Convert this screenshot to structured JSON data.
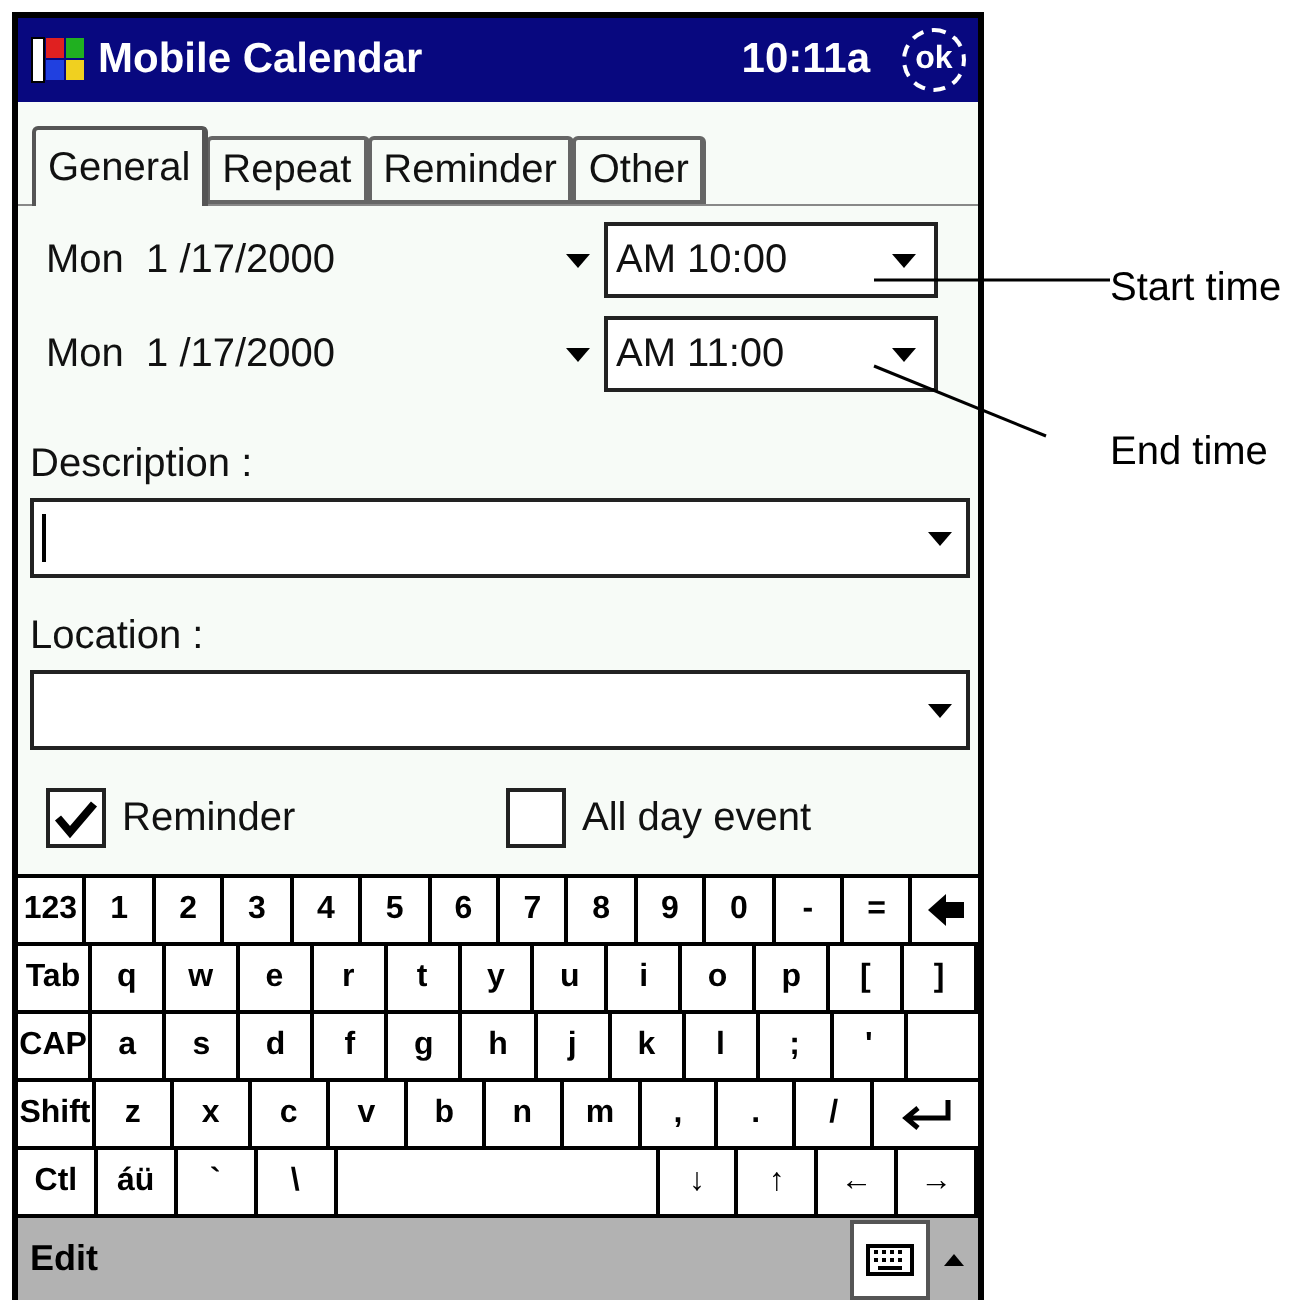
{
  "title_bar": {
    "app_name": "Mobile Calendar",
    "time": "10:11a",
    "ok_button": "ok"
  },
  "tabs": [
    {
      "label": "General",
      "selected": true
    },
    {
      "label": "Repeat",
      "selected": false
    },
    {
      "label": "Reminder",
      "selected": false
    },
    {
      "label": "Other",
      "selected": false
    }
  ],
  "date_rows": [
    {
      "date": "Mon  1 /17/2000",
      "time": "AM 10:00"
    },
    {
      "date": "Mon  1 /17/2000",
      "time": "AM 11:00"
    }
  ],
  "text_fields": [
    {
      "label": "Description :",
      "focused": true
    },
    {
      "label": "Location :",
      "focused": false
    }
  ],
  "options": [
    {
      "label": "Reminder",
      "checked": true
    },
    {
      "label": "All day event",
      "checked": false
    }
  ],
  "keyboard": [
    [
      {
        "kind": "char",
        "label": "123"
      },
      {
        "kind": "char",
        "label": "1"
      },
      {
        "kind": "char",
        "label": "2"
      },
      {
        "kind": "char",
        "label": "3"
      },
      {
        "kind": "char",
        "label": "4"
      },
      {
        "kind": "char",
        "label": "5"
      },
      {
        "kind": "char",
        "label": "6"
      },
      {
        "kind": "char",
        "label": "7"
      },
      {
        "kind": "char",
        "label": "8"
      },
      {
        "kind": "char",
        "label": "9"
      },
      {
        "kind": "char",
        "label": "0"
      },
      {
        "kind": "char",
        "label": "-"
      },
      {
        "kind": "char",
        "label": "="
      },
      {
        "kind": "backspace"
      }
    ],
    [
      {
        "kind": "char",
        "label": "Tab"
      },
      {
        "kind": "char",
        "label": "q"
      },
      {
        "kind": "char",
        "label": "w"
      },
      {
        "kind": "char",
        "label": "e"
      },
      {
        "kind": "char",
        "label": "r"
      },
      {
        "kind": "char",
        "label": "t"
      },
      {
        "kind": "char",
        "label": "y"
      },
      {
        "kind": "char",
        "label": "u"
      },
      {
        "kind": "char",
        "label": "i"
      },
      {
        "kind": "char",
        "label": "o"
      },
      {
        "kind": "char",
        "label": "p"
      },
      {
        "kind": "char",
        "label": "["
      },
      {
        "kind": "char",
        "label": "]"
      }
    ],
    [
      {
        "kind": "char",
        "label": "CAP"
      },
      {
        "kind": "char",
        "label": "a"
      },
      {
        "kind": "char",
        "label": "s"
      },
      {
        "kind": "char",
        "label": "d"
      },
      {
        "kind": "char",
        "label": "f"
      },
      {
        "kind": "char",
        "label": "g"
      },
      {
        "kind": "char",
        "label": "h"
      },
      {
        "kind": "char",
        "label": "j"
      },
      {
        "kind": "char",
        "label": "k"
      },
      {
        "kind": "char",
        "label": "l"
      },
      {
        "kind": "char",
        "label": ";"
      },
      {
        "kind": "char",
        "label": "'"
      },
      {
        "kind": "blank"
      }
    ],
    [
      {
        "kind": "char",
        "label": "Shift"
      },
      {
        "kind": "char",
        "label": "z"
      },
      {
        "kind": "char",
        "label": "x"
      },
      {
        "kind": "char",
        "label": "c"
      },
      {
        "kind": "char",
        "label": "v"
      },
      {
        "kind": "char",
        "label": "b"
      },
      {
        "kind": "char",
        "label": "n"
      },
      {
        "kind": "char",
        "label": "m"
      },
      {
        "kind": "char",
        "label": ","
      },
      {
        "kind": "char",
        "label": "."
      },
      {
        "kind": "char",
        "label": "/"
      },
      {
        "kind": "enter"
      }
    ],
    [
      {
        "kind": "char",
        "label": "Ctl"
      },
      {
        "kind": "char",
        "label": "áü"
      },
      {
        "kind": "char",
        "label": "`"
      },
      {
        "kind": "char",
        "label": "\\"
      },
      {
        "kind": "space"
      },
      {
        "kind": "char",
        "label": "↓"
      },
      {
        "kind": "char",
        "label": "↑"
      },
      {
        "kind": "char",
        "label": "←"
      },
      {
        "kind": "char",
        "label": "→"
      }
    ]
  ],
  "menu_bar": {
    "items": [
      "Edit"
    ]
  },
  "annotations": [
    {
      "label": "Start time"
    },
    {
      "label": "End time"
    }
  ]
}
